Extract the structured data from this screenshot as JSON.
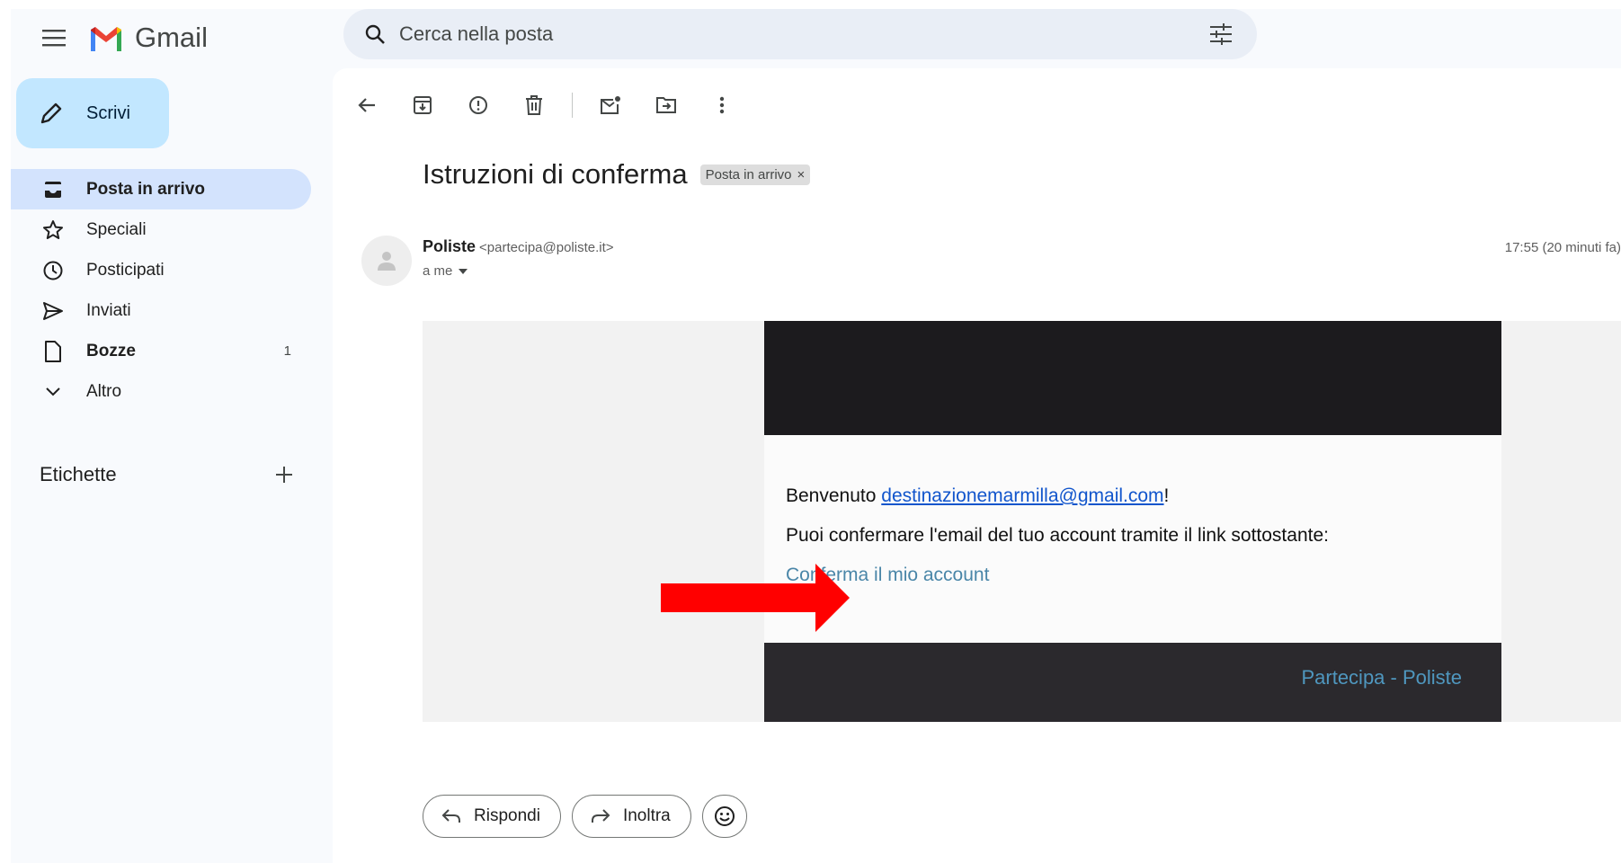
{
  "header": {
    "app_name": "Gmail",
    "search_placeholder": "Cerca nella posta"
  },
  "compose": {
    "label": "Scrivi"
  },
  "nav": {
    "items": [
      {
        "label": "Posta in arrivo",
        "icon": "inbox-icon",
        "active": true,
        "bold": true
      },
      {
        "label": "Speciali",
        "icon": "star-icon"
      },
      {
        "label": "Posticipati",
        "icon": "clock-icon"
      },
      {
        "label": "Inviati",
        "icon": "send-icon"
      },
      {
        "label": "Bozze",
        "icon": "draft-icon",
        "bold": true,
        "count": "1"
      },
      {
        "label": "Altro",
        "icon": "chevron-down-icon"
      }
    ],
    "labels_title": "Etichette"
  },
  "message": {
    "subject": "Istruzioni di conferma",
    "label_chip": "Posta in arrivo",
    "chip_close": "×",
    "sender_name": "Poliste",
    "sender_address": "<partecipa@poliste.it>",
    "recipient": "a me",
    "time": "17:55 (20 minuti fa)"
  },
  "body": {
    "welcome_prefix": "Benvenuto ",
    "welcome_email": "destinazionemarmilla@gmail.com",
    "welcome_suffix": "!",
    "instructions": "Puoi confermare l'email del tuo account tramite il link sottostante:",
    "confirm_link": "Conferma il mio account",
    "footer_link": "Partecipa - Poliste"
  },
  "actions": {
    "reply": "Rispondi",
    "forward": "Inoltra"
  },
  "colors": {
    "compose_bg": "#c2e7ff",
    "nav_active_bg": "#d3e3fd",
    "search_bg": "#e9eef6",
    "arrow": "#ff0000",
    "email_dark": "#1c1b1e",
    "footer_link": "#4f97bf"
  }
}
